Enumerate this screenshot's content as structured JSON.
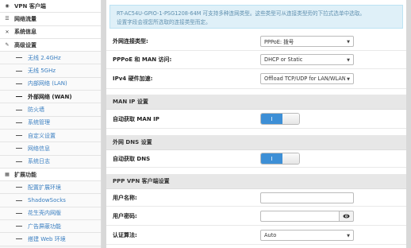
{
  "sidebar": {
    "items": [
      {
        "label": "VPN 客户端",
        "icon": "globe-icon",
        "glyph": "◉"
      },
      {
        "label": "网络流量",
        "icon": "list-icon",
        "glyph": "☰"
      },
      {
        "label": "系统信息",
        "icon": "shuffle-icon",
        "glyph": "✕"
      },
      {
        "label": "高级设置",
        "icon": "wrench-icon",
        "glyph": "✎"
      }
    ],
    "advanced_sub": [
      {
        "label": "无线 2.4GHz"
      },
      {
        "label": "无线 5GHz"
      },
      {
        "label": "内部网络 (LAN)"
      },
      {
        "label": "外部网络 (WAN)"
      },
      {
        "label": "防火墙"
      },
      {
        "label": "系统管理"
      },
      {
        "label": "自定义设置"
      },
      {
        "label": "网络信息"
      },
      {
        "label": "系统日志"
      }
    ],
    "extensions": {
      "label": "扩展功能",
      "icon": "grid-icon",
      "glyph": "▦"
    },
    "ext_sub": [
      {
        "label": "配置扩展环境"
      },
      {
        "label": "ShadowSocks"
      },
      {
        "label": "花生壳内网版"
      },
      {
        "label": "广告屏蔽功能"
      },
      {
        "label": "搭建 Web 环境"
      }
    ]
  },
  "alert": {
    "line1": "RT-AC54U-GPIO-1-PSG1208-64M 可支持多种连网类型。这些类型可从连接类型旁的下拉式选单中选取。",
    "line2": "设置字段会视您所选取的连接类型而定。"
  },
  "wan": {
    "conn_type_label": "外网连接类型:",
    "conn_type_value": "PPPoE: 拨号",
    "pppoe_man_label": "PPPoE 和 MAN 访问:",
    "pppoe_man_value": "DHCP or Static",
    "hw_accel_label": "IPv4 硬件加速:",
    "hw_accel_value": "Offload TCP/UDP for LAN/WLAN"
  },
  "man_ip": {
    "section": "MAN IP 设置",
    "auto_label": "自动获取 MAN IP",
    "toggle_text": "I"
  },
  "dns": {
    "section": "外网 DNS 设置",
    "auto_label": "自动获取 DNS",
    "toggle_text": "I"
  },
  "ppp": {
    "section": "PPP VPN 客户端设置",
    "user_label": "用户名称:",
    "user_value": "",
    "pass_label": "用户密码:",
    "pass_value": "",
    "auth_label": "认证算法:",
    "auth_value": "Auto"
  }
}
